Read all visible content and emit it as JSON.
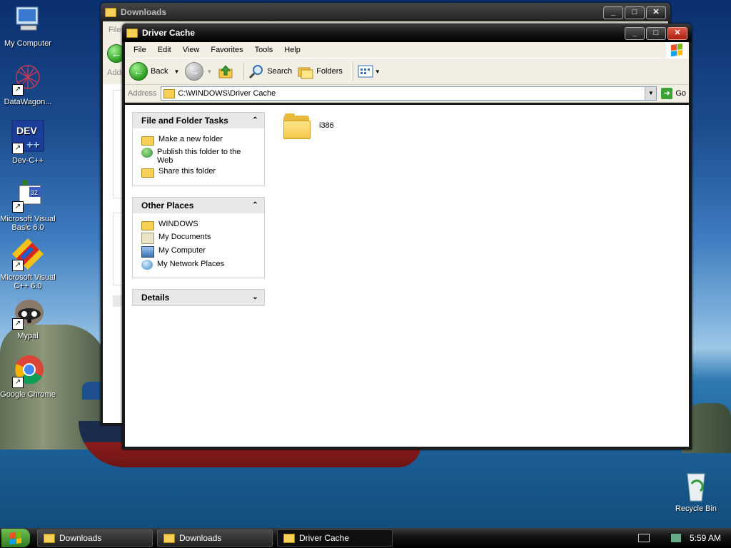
{
  "desktop": {
    "icons": [
      {
        "label": "My Computer",
        "icon": "computer-icon"
      },
      {
        "label": "DataWagon...",
        "icon": "datawagon-icon"
      },
      {
        "label": "Dev-C++",
        "icon": "devcpp-icon"
      },
      {
        "label": "Microsoft Visual Basic 6.0",
        "icon": "vb6-icon"
      },
      {
        "label": "Microsoft Visual C++ 6.0",
        "icon": "vc6-icon"
      },
      {
        "label": "Mypal",
        "icon": "mypal-icon"
      },
      {
        "label": "Google Chrome",
        "icon": "chrome-icon"
      },
      {
        "label": "Recycle Bin",
        "icon": "recycle-bin-icon"
      }
    ]
  },
  "back_window": {
    "title": "Downloads",
    "menu_fragment": "File",
    "address_fragment": "Addr"
  },
  "window": {
    "title": "Driver Cache",
    "menu": [
      "File",
      "Edit",
      "View",
      "Favorites",
      "Tools",
      "Help"
    ],
    "toolbar": {
      "back": "Back",
      "search": "Search",
      "folders": "Folders"
    },
    "address": {
      "label": "Address",
      "value": "C:\\WINDOWS\\Driver Cache",
      "go": "Go"
    },
    "tasks": {
      "title": "File and Folder Tasks",
      "items": [
        "Make a new folder",
        "Publish this folder to the Web",
        "Share this folder"
      ]
    },
    "places": {
      "title": "Other Places",
      "items": [
        "WINDOWS",
        "My Documents",
        "My Computer",
        "My Network Places"
      ]
    },
    "details": {
      "title": "Details"
    },
    "files": [
      {
        "name": "i386",
        "type": "folder"
      }
    ]
  },
  "taskbar": {
    "buttons": [
      "Downloads",
      "Downloads",
      "Driver Cache"
    ],
    "active_index": 2,
    "clock": "5:59 AM"
  }
}
